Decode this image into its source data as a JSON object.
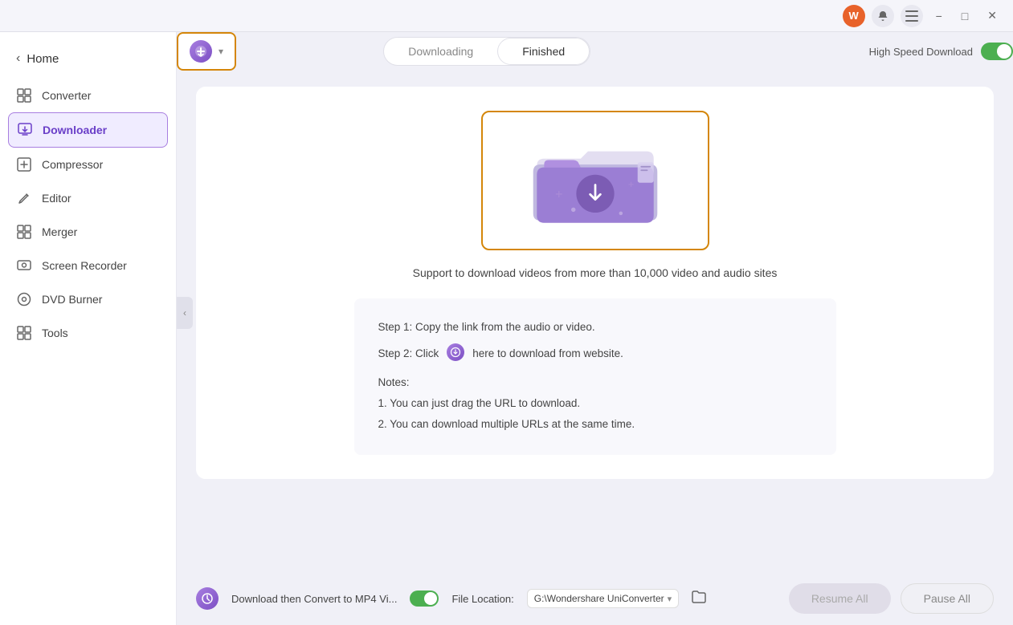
{
  "titlebar": {
    "user_icon": "W",
    "bell_icon": "🔔",
    "menu_icon": "☰",
    "minimize": "−",
    "maximize": "□",
    "close": "✕"
  },
  "sidebar": {
    "back_label": "Home",
    "items": [
      {
        "id": "converter",
        "label": "Converter",
        "icon": "⊞"
      },
      {
        "id": "downloader",
        "label": "Downloader",
        "icon": "⬇",
        "active": true
      },
      {
        "id": "compressor",
        "label": "Compressor",
        "icon": "⊡"
      },
      {
        "id": "editor",
        "label": "Editor",
        "icon": "✂"
      },
      {
        "id": "merger",
        "label": "Merger",
        "icon": "⊞"
      },
      {
        "id": "screen-recorder",
        "label": "Screen Recorder",
        "icon": "⊙"
      },
      {
        "id": "dvd-burner",
        "label": "DVD Burner",
        "icon": "⊙"
      },
      {
        "id": "tools",
        "label": "Tools",
        "icon": "⊞"
      }
    ]
  },
  "topbar": {
    "add_btn_label": "▾",
    "tabs": [
      {
        "id": "downloading",
        "label": "Downloading",
        "active": false
      },
      {
        "id": "finished",
        "label": "Finished",
        "active": true
      }
    ],
    "speed_toggle_label": "High Speed Download"
  },
  "main": {
    "support_text": "Support to download videos from more than 10,000 video and audio sites",
    "step1": "Step 1: Copy the link from the audio or video.",
    "step2_prefix": "Step 2: Click",
    "step2_suffix": "here to download from website.",
    "notes_title": "Notes:",
    "note1": "1. You can just drag the URL to download.",
    "note2": "2. You can download multiple URLs at the same time."
  },
  "bottombar": {
    "convert_label": "Download then Convert to MP4 Vi...",
    "file_location_label": "File Location:",
    "file_path": "G:\\Wondershare UniConverter",
    "resume_btn": "Resume All",
    "pause_btn": "Pause All"
  }
}
